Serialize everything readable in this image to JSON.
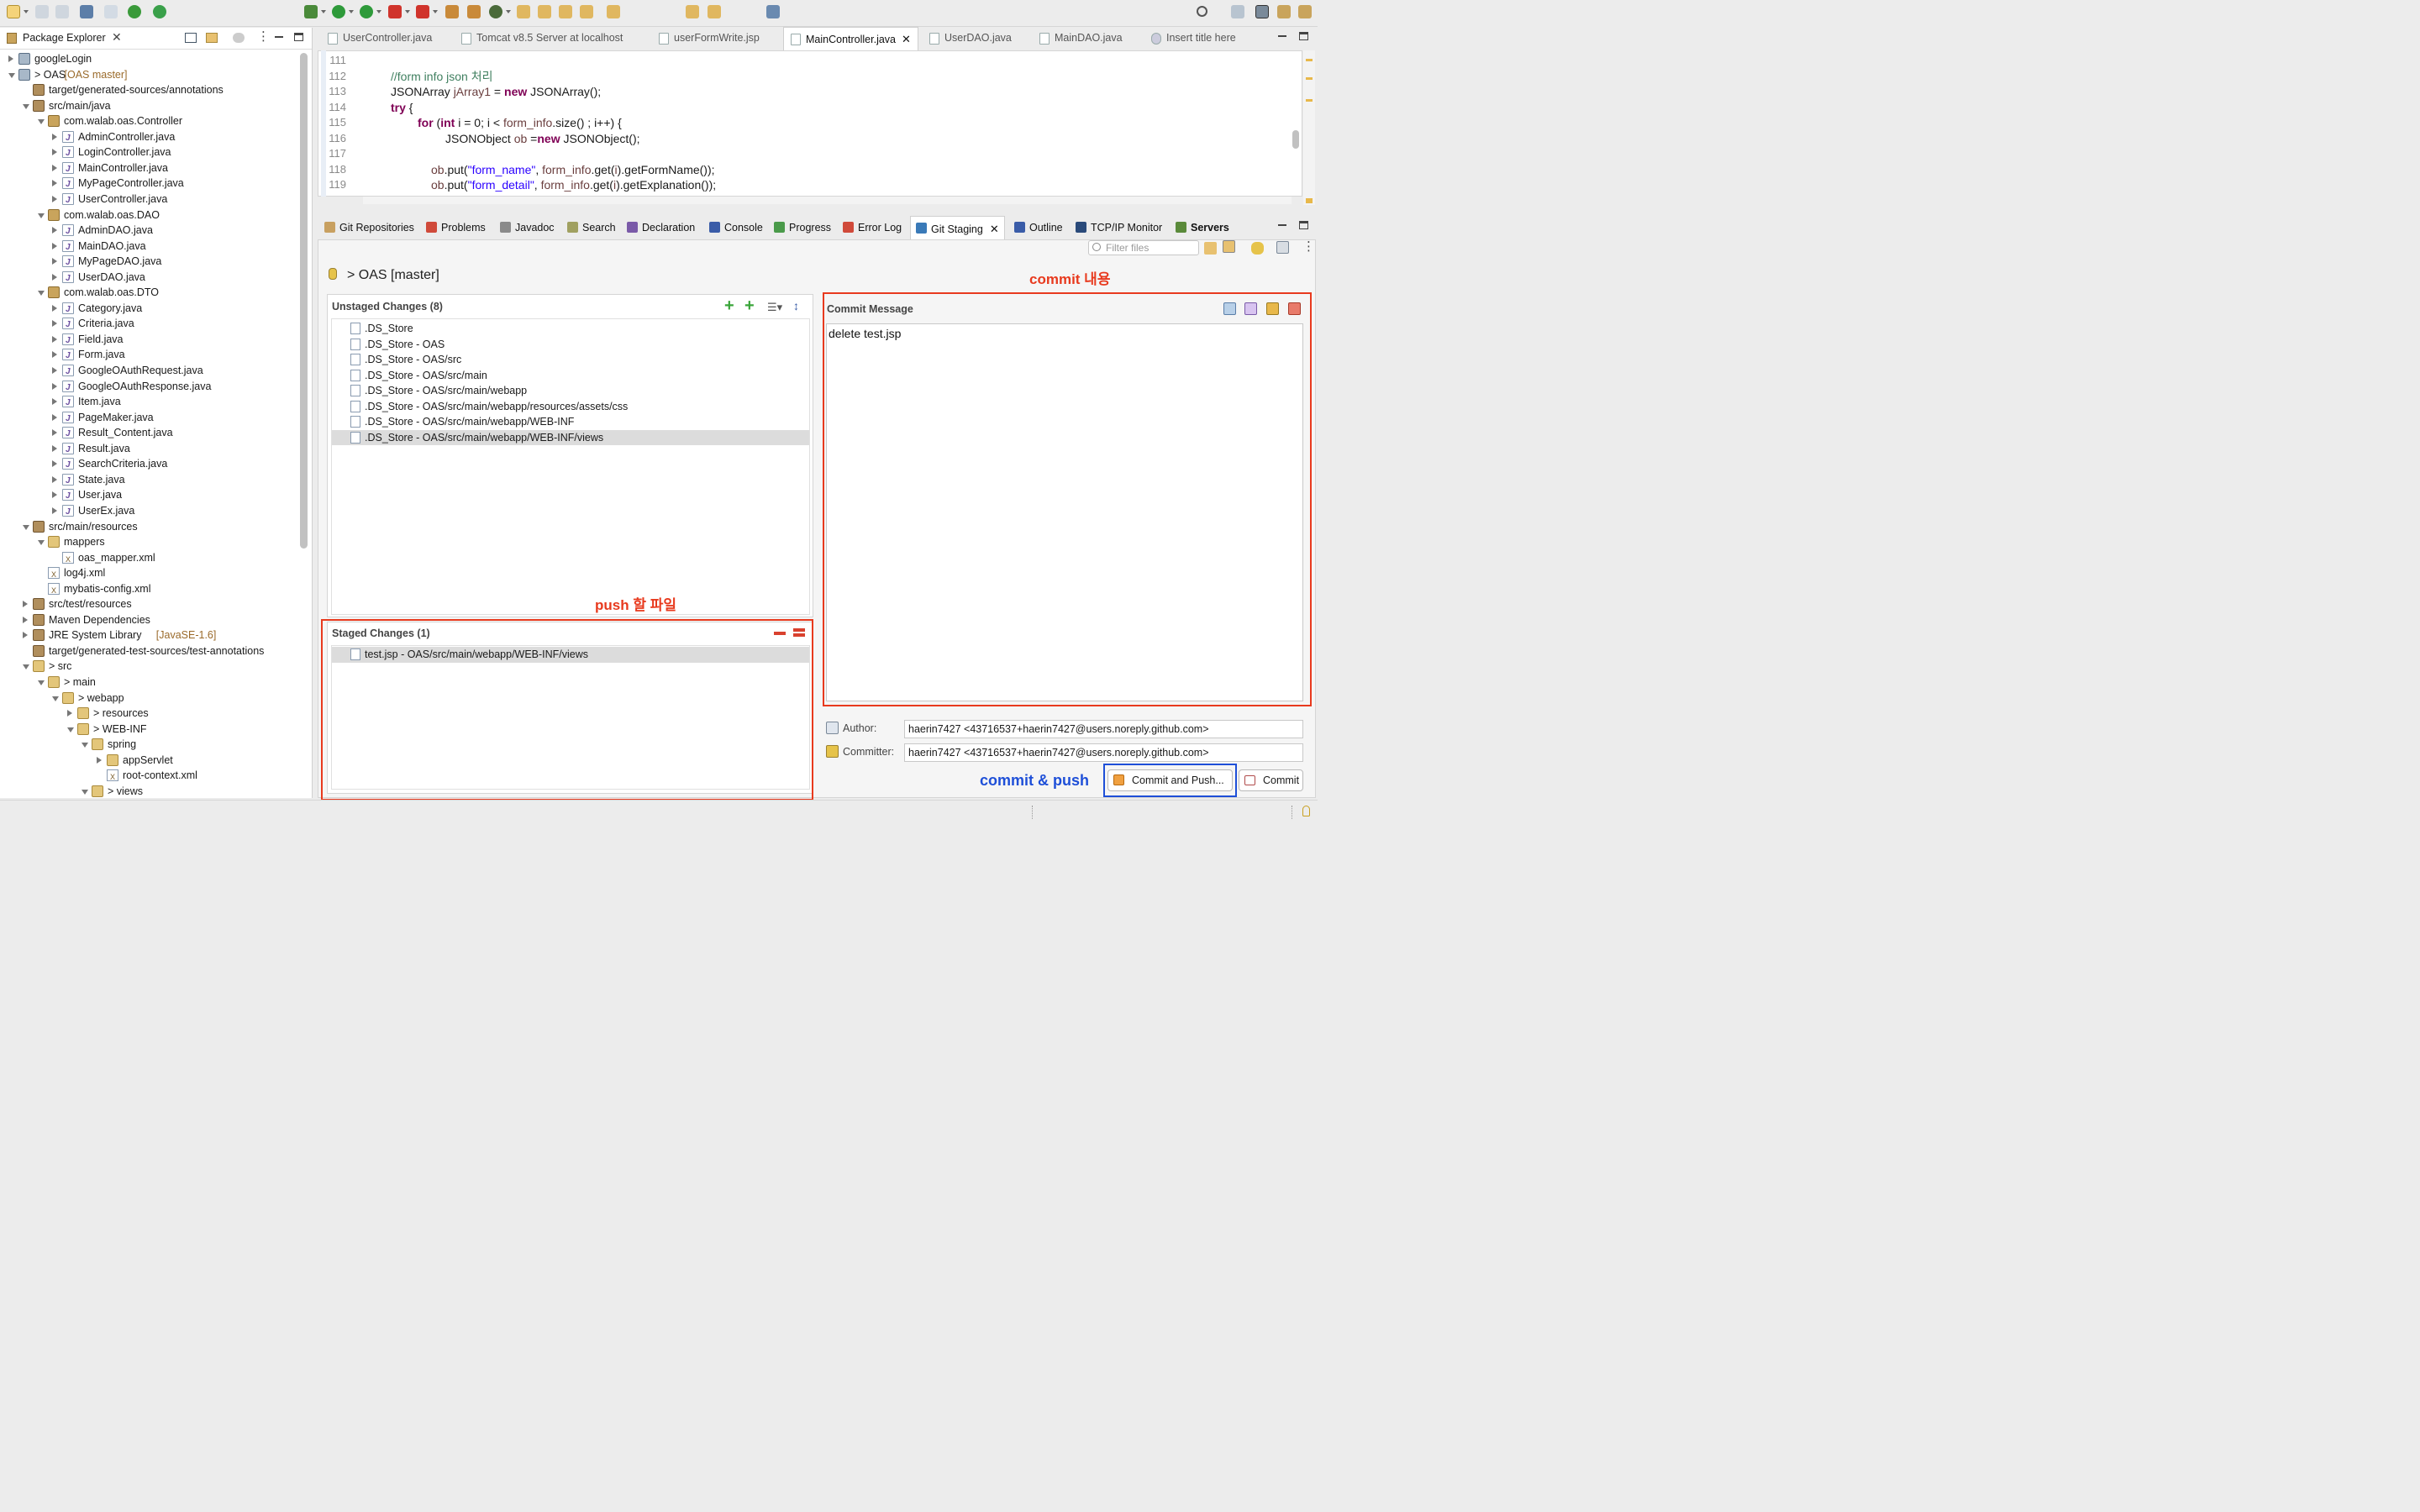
{
  "toolbar": {
    "icon_names": [
      "new-icon",
      "save-icon",
      "save-all-icon",
      "print-icon",
      "debug-icon",
      "run-icon",
      "run-external-icon",
      "stop-icon",
      "search-icon",
      "perspective-icon"
    ]
  },
  "editor_tabs": [
    {
      "label": "UserController.java",
      "active": false
    },
    {
      "label": "Tomcat v8.5 Server at localhost",
      "active": false
    },
    {
      "label": "userFormWrite.jsp",
      "active": false
    },
    {
      "label": "MainController.java",
      "active": true
    },
    {
      "label": "UserDAO.java",
      "active": false
    },
    {
      "label": "MainDAO.java",
      "active": false
    },
    {
      "label": "Insert title here",
      "active": false
    }
  ],
  "package_explorer": {
    "title": "Package Explorer",
    "tree": [
      {
        "label": "googleLogin",
        "icon": "project"
      },
      {
        "label": "> OAS",
        "suffix": " [OAS master]",
        "icon": "project"
      },
      {
        "label": "target/generated-sources/annotations",
        "icon": "src-folder"
      },
      {
        "label": "src/main/java",
        "icon": "src-folder"
      },
      {
        "label": "com.walab.oas.Controller",
        "icon": "package"
      },
      {
        "label": "AdminController.java",
        "icon": "java"
      },
      {
        "label": "LoginController.java",
        "icon": "java"
      },
      {
        "label": "MainController.java",
        "icon": "java"
      },
      {
        "label": "MyPageController.java",
        "icon": "java"
      },
      {
        "label": "UserController.java",
        "icon": "java"
      },
      {
        "label": "com.walab.oas.DAO",
        "icon": "package"
      },
      {
        "label": "AdminDAO.java",
        "icon": "java"
      },
      {
        "label": "MainDAO.java",
        "icon": "java"
      },
      {
        "label": "MyPageDAO.java",
        "icon": "java"
      },
      {
        "label": "UserDAO.java",
        "icon": "java"
      },
      {
        "label": "com.walab.oas.DTO",
        "icon": "package"
      },
      {
        "label": "Category.java",
        "icon": "java"
      },
      {
        "label": "Criteria.java",
        "icon": "java"
      },
      {
        "label": "Field.java",
        "icon": "java"
      },
      {
        "label": "Form.java",
        "icon": "java"
      },
      {
        "label": "GoogleOAuthRequest.java",
        "icon": "java"
      },
      {
        "label": "GoogleOAuthResponse.java",
        "icon": "java"
      },
      {
        "label": "Item.java",
        "icon": "java"
      },
      {
        "label": "PageMaker.java",
        "icon": "java"
      },
      {
        "label": "Result_Content.java",
        "icon": "java"
      },
      {
        "label": "Result.java",
        "icon": "java"
      },
      {
        "label": "SearchCriteria.java",
        "icon": "java"
      },
      {
        "label": "State.java",
        "icon": "java"
      },
      {
        "label": "User.java",
        "icon": "java"
      },
      {
        "label": "UserEx.java",
        "icon": "java"
      },
      {
        "label": "src/main/resources",
        "icon": "src-folder"
      },
      {
        "label": "mappers",
        "icon": "folder"
      },
      {
        "label": "oas_mapper.xml",
        "icon": "xml"
      },
      {
        "label": "log4j.xml",
        "icon": "xml"
      },
      {
        "label": "mybatis-config.xml",
        "icon": "xml"
      },
      {
        "label": "src/test/resources",
        "icon": "src-folder"
      },
      {
        "label": "Maven Dependencies",
        "icon": "library"
      },
      {
        "label": "JRE System Library",
        "suffix": " [JavaSE-1.6]",
        "icon": "library"
      },
      {
        "label": "target/generated-test-sources/test-annotations",
        "icon": "src-folder"
      },
      {
        "label": "> src",
        "icon": "folder"
      },
      {
        "label": "> main",
        "icon": "folder"
      },
      {
        "label": "> webapp",
        "icon": "folder"
      },
      {
        "label": "> resources",
        "icon": "folder"
      },
      {
        "label": "> WEB-INF",
        "icon": "folder"
      },
      {
        "label": "spring",
        "icon": "folder"
      },
      {
        "label": "appServlet",
        "icon": "folder"
      },
      {
        "label": "root-context.xml",
        "icon": "xml"
      },
      {
        "label": "> views",
        "icon": "folder"
      }
    ]
  },
  "code": {
    "line_numbers": [
      "111",
      "112",
      "113",
      "114",
      "115",
      "116",
      "117",
      "118",
      "119"
    ],
    "l112": "//form info json 처리",
    "l113a": "JSONArray ",
    "l113b": "jArray1",
    "l113c": " = ",
    "l113d": "new",
    "l113e": " JSONArray();",
    "l114": "try",
    "l114b": " {",
    "l115a": "for",
    "l115b": " (",
    "l115c": "int",
    "l115d": " i = 0; i < ",
    "l115e": "form_info",
    "l115f": ".size() ; i++) {",
    "l116a": "JSONObject ",
    "l116b": "ob",
    "l116c": " =",
    "l116d": "new",
    "l116e": " JSONObject();",
    "l118a": "ob",
    "l118b": ".put(",
    "l118c": "\"form_name\"",
    "l118d": ", ",
    "l118e": "form_info",
    "l118f": ".get(",
    "l118g": "i",
    "l118h": ").getFormName());",
    "l119a": "ob",
    "l119b": ".put(",
    "l119c": "\"form_detail\"",
    "l119d": ", ",
    "l119e": "form_info",
    "l119f": ".get(",
    "l119g": "i",
    "l119h": ").getExplanation());"
  },
  "view_tabs": [
    {
      "label": "Git Repositories",
      "icon": "git-repo-icon"
    },
    {
      "label": "Problems",
      "icon": "problems-icon"
    },
    {
      "label": "Javadoc",
      "icon": "javadoc-icon"
    },
    {
      "label": "Search",
      "icon": "search-view-icon"
    },
    {
      "label": "Declaration",
      "icon": "declaration-icon"
    },
    {
      "label": "Console",
      "icon": "console-icon"
    },
    {
      "label": "Progress",
      "icon": "progress-icon"
    },
    {
      "label": "Error Log",
      "icon": "error-log-icon"
    },
    {
      "label": "Git Staging",
      "icon": "git-staging-icon",
      "active": true
    },
    {
      "label": "Outline",
      "icon": "outline-icon"
    },
    {
      "label": "TCP/IP Monitor",
      "icon": "monitor-icon"
    },
    {
      "label": "Servers",
      "icon": "servers-icon",
      "bold": true
    }
  ],
  "git_staging": {
    "filter_placeholder": "Filter files",
    "repo_title": "> OAS [master]",
    "unstaged_title": "Unstaged Changes (8)",
    "unstaged": [
      ".DS_Store",
      ".DS_Store - OAS",
      ".DS_Store - OAS/src",
      ".DS_Store - OAS/src/main",
      ".DS_Store - OAS/src/main/webapp",
      ".DS_Store - OAS/src/main/webapp/resources/assets/css",
      ".DS_Store - OAS/src/main/webapp/WEB-INF",
      ".DS_Store - OAS/src/main/webapp/WEB-INF/views"
    ],
    "staged_title": "Staged Changes (1)",
    "staged": [
      "test.jsp - OAS/src/main/webapp/WEB-INF/views"
    ],
    "commit_message_title": "Commit Message",
    "commit_message": "delete test.jsp",
    "author_label": "Author:",
    "author": "haerin7427 <43716537+haerin7427@users.noreply.github.com>",
    "committer_label": "Committer:",
    "committer": "haerin7427 <43716537+haerin7427@users.noreply.github.com>",
    "commit_push_button": "Commit and Push...",
    "commit_button": "Commit"
  },
  "annotations": {
    "commit_content": "commit 내용",
    "push_files": "push 할 파일",
    "commit_push": "commit & push"
  },
  "colors": {
    "annotation_red": "#e83a1e",
    "annotation_blue": "#1e4fd8"
  }
}
